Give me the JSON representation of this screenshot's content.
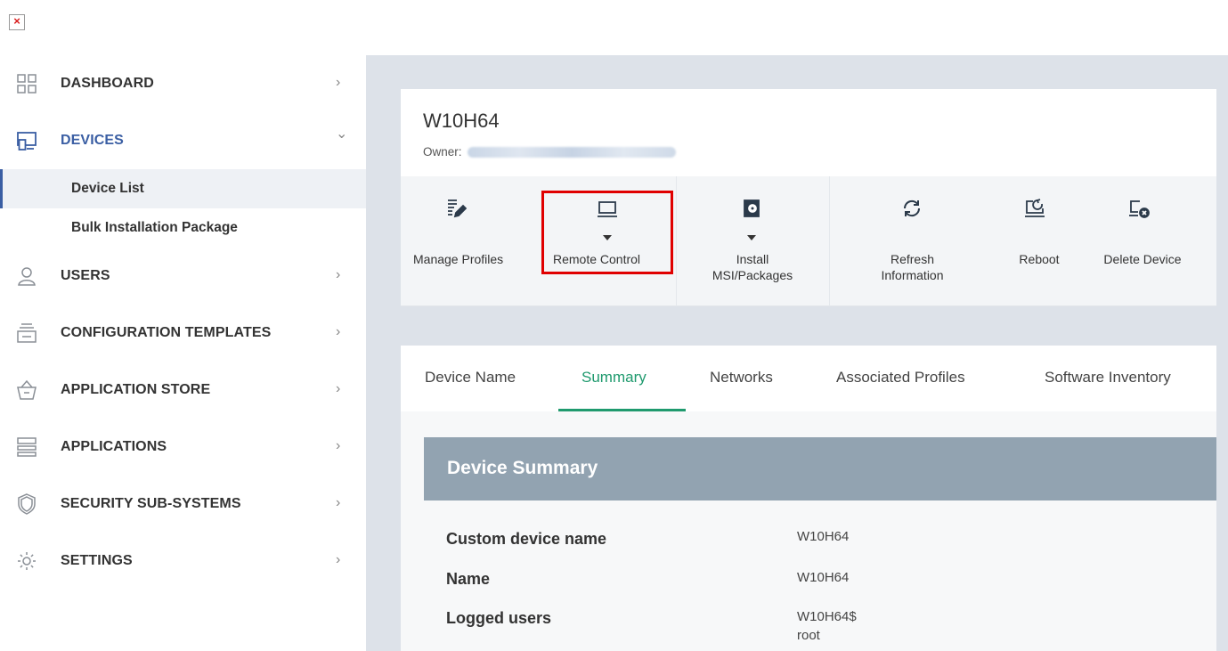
{
  "window": {
    "close_glyph": "×"
  },
  "sidebar": {
    "items": [
      {
        "label": "DASHBOARD",
        "icon": "dashboard-grid-icon",
        "chevron": "›"
      },
      {
        "label": "DEVICES",
        "icon": "devices-icon",
        "chevron": "⌄",
        "subitems": [
          {
            "label": "Device List",
            "active": true
          },
          {
            "label": "Bulk Installation Package",
            "active": false
          }
        ]
      },
      {
        "label": "USERS",
        "icon": "user-icon",
        "chevron": "›"
      },
      {
        "label": "CONFIGURATION TEMPLATES",
        "icon": "templates-icon",
        "chevron": "›"
      },
      {
        "label": "APPLICATION STORE",
        "icon": "store-basket-icon",
        "chevron": "›"
      },
      {
        "label": "APPLICATIONS",
        "icon": "applications-icon",
        "chevron": "›"
      },
      {
        "label": "SECURITY SUB-SYSTEMS",
        "icon": "shield-icon",
        "chevron": "›"
      },
      {
        "label": "SETTINGS",
        "icon": "gear-icon",
        "chevron": "›"
      }
    ]
  },
  "device": {
    "title": "W10H64",
    "owner_label": "Owner:"
  },
  "toolbar": {
    "manage_profiles": "Manage Profiles",
    "remote_control": "Remote Control",
    "install_line1": "Install",
    "install_line2": "MSI/Packages",
    "refresh_line1": "Refresh",
    "refresh_line2": "Information",
    "reboot": "Reboot",
    "delete_device": "Delete Device"
  },
  "tabs": [
    "Device Name",
    "Summary",
    "Networks",
    "Associated Profiles",
    "Software Inventory"
  ],
  "active_tab": "Summary",
  "summary": {
    "header": "Device Summary",
    "rows": [
      {
        "label": "Custom device name",
        "value": "W10H64"
      },
      {
        "label": "Name",
        "value": "W10H64"
      },
      {
        "label": "Logged users",
        "value": "W10H64$",
        "value2": "root"
      }
    ]
  },
  "colors": {
    "accent_green": "#1f9a6e",
    "highlight_red": "#e00000",
    "summary_header": "#92a3b1",
    "active_border": "#3a5ea3"
  }
}
